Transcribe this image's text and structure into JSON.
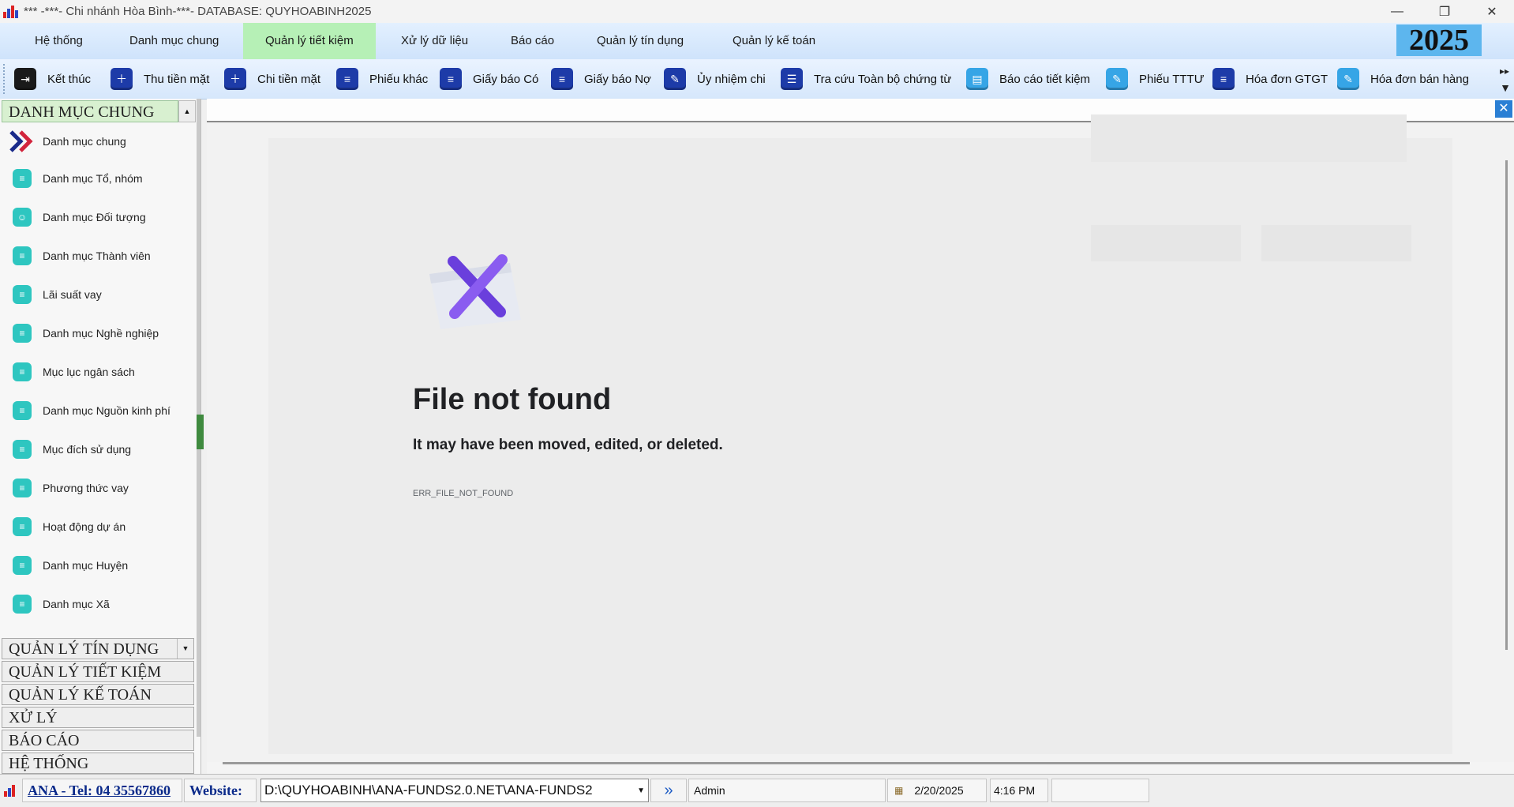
{
  "window": {
    "title": "*** -***- Chi nhánh Hòa Bình-***- DATABASE: QUYHOABINH2025",
    "min": "—",
    "restore": "❐",
    "close": "✕"
  },
  "menu": {
    "items": [
      "Hệ thống",
      "Danh mục chung",
      "Quản lý tiết kiệm",
      "Xử lý dữ liệu",
      "Báo cáo",
      "Quản lý tín dụng",
      "Quản lý kế toán"
    ],
    "active_index": 2,
    "year": "2025"
  },
  "toolbar": {
    "items": [
      "Kết thúc",
      "Thu tiền mặt",
      "Chi tiền mặt",
      "Phiếu khác",
      "Giấy báo Có",
      "Giấy báo Nợ",
      "Ủy nhiệm chi",
      "Tra cứu Toàn bộ chứng từ",
      "Báo cáo tiết kiệm",
      "Phiếu TTTƯ",
      "Hóa đơn GTGT",
      "Hóa đơn bán hàng"
    ],
    "overflow": "▸▸"
  },
  "sidebar": {
    "header": "DANH MỤC CHUNG",
    "items": [
      "Danh mục chung",
      "Danh mục Tổ, nhóm",
      "Danh mục Đối tượng",
      "Danh mục Thành viên",
      "Lãi suất vay",
      "Danh mục Nghề nghiệp",
      "Mục lục ngân sách",
      "Danh mục Nguồn kinh phí",
      "Mục đích sử dụng",
      "Phương thức vay",
      "Hoạt động dự án",
      "Danh mục Huyện",
      "Danh mục Xã"
    ],
    "sections": [
      "QUẢN LÝ TÍN DỤNG",
      "QUẢN LÝ TIẾT KIỆM",
      "QUẢN LÝ KẾ TOÁN",
      "XỬ LÝ",
      "BÁO CÁO",
      "HỆ THỐNG"
    ]
  },
  "error": {
    "title": "File not found",
    "subtitle": "It may have been moved, edited, or deleted.",
    "code": "ERR_FILE_NOT_FOUND"
  },
  "status": {
    "phone": "ANA - Tel: 04 35567860",
    "website_label": "Website:",
    "path": "D:\\QUYHOABINH\\ANA-FUNDS2.0.NET\\ANA-FUNDS2",
    "user": "Admin",
    "date": "2/20/2025",
    "time": "4:16 PM"
  },
  "colors": {
    "menu_active": "#b6f0b6",
    "year_bg": "#5db6ee",
    "toolbar_icon": "#1d3ba8",
    "sidebar_icon": "#2ec6c0",
    "error_x": "#7b47e0"
  }
}
